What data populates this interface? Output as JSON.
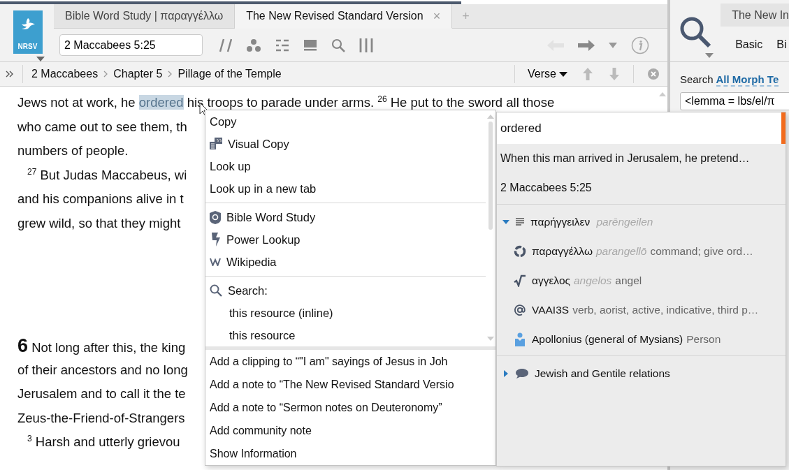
{
  "logo": {
    "label": "NRSV"
  },
  "tabs": [
    {
      "label": "Bible Word Study | παραγγέλλω",
      "selected": false
    },
    {
      "label": "The New Revised Standard Version",
      "selected": true,
      "close": "×"
    }
  ],
  "new_tab": "+",
  "reference_field": {
    "value": "2 Maccabees 5:25"
  },
  "history": {
    "back": {
      "disabled": true
    },
    "forward": {
      "disabled": false
    }
  },
  "breadcrumb": [
    "2 Maccabees",
    "Chapter 5",
    "Pillage of the Temple"
  ],
  "verse_dropdown": {
    "label": "Verse"
  },
  "text_lines": [
    {
      "parts": [
        {
          "kind": "text",
          "t": "Jews not at work, he "
        },
        {
          "kind": "selection",
          "t": "ordered"
        },
        {
          "kind": "text",
          "t": " his troops to parade under arms. "
        },
        {
          "kind": "verse",
          "t": "26"
        },
        {
          "kind": "text",
          "t": " He put to the sword all those"
        }
      ]
    },
    {
      "parts": [
        {
          "kind": "text",
          "t": "who came out to see them, th"
        }
      ]
    },
    {
      "parts": [
        {
          "kind": "text",
          "t": "numbers of people."
        }
      ]
    },
    {
      "indent": true,
      "parts": [
        {
          "kind": "verse",
          "t": "27"
        },
        {
          "kind": "text",
          "t": " But Judas Maccabeus, wi"
        }
      ]
    },
    {
      "parts": [
        {
          "kind": "text",
          "t": "and his companions alive in t"
        }
      ]
    },
    {
      "parts": [
        {
          "kind": "text",
          "t": "grew wild, so that they might"
        }
      ]
    },
    {
      "gap_before": true,
      "parts": [
        {
          "kind": "chapter",
          "t": "6"
        },
        {
          "kind": "text",
          "t": " Not long after this, the king"
        }
      ]
    },
    {
      "parts": [
        {
          "kind": "text",
          "t": "of their ancestors and no long"
        }
      ]
    },
    {
      "parts": [
        {
          "kind": "text",
          "t": "Jerusalem and to call it the te"
        }
      ]
    },
    {
      "parts": [
        {
          "kind": "text",
          "t": "Zeus-the-Friend-of-Strangers"
        }
      ]
    },
    {
      "indent": true,
      "parts": [
        {
          "kind": "verse",
          "t": "3"
        },
        {
          "kind": "text",
          "t": " Harsh and utterly grievou"
        }
      ]
    }
  ],
  "context_menu": {
    "sections": [
      {
        "items": [
          {
            "label": "Copy",
            "kind": "plain"
          },
          {
            "label": "Visual Copy",
            "kind": "icon"
          },
          {
            "label": "Look up",
            "kind": "plain"
          },
          {
            "label": "Look up in a new tab",
            "kind": "plain"
          }
        ]
      },
      {
        "items": [
          {
            "label": "Bible Word Study",
            "kind": "icon"
          },
          {
            "label": "Power Lookup",
            "kind": "icon"
          },
          {
            "label": "Wikipedia",
            "kind": "icon"
          }
        ]
      },
      {
        "items": [
          {
            "label": "Search:",
            "kind": "icon"
          },
          {
            "label": "this resource (inline)",
            "kind": "sub"
          },
          {
            "label": "this resource",
            "kind": "sub"
          }
        ]
      }
    ],
    "lower_items": [
      "Add a clipping to “\"I am\" sayings of Jesus in Joh",
      "Add a note to “The New Revised Standard Versio",
      "Add a note to “Sermon notes on Deuteronomy”",
      "Add community note",
      "Show Information"
    ]
  },
  "info_panel": {
    "word": "ordered",
    "excerpt": "When this man arrived in Jerusalem, he pretend…",
    "reference": "2 Maccabees 5:25",
    "tree": [
      {
        "lemma": "παρήγγειλεν",
        "translit": "parēngeilen",
        "expanded": true,
        "children": [
          {
            "lemma": "παραγγέλλω",
            "translit": "parangellō",
            "gloss": "command; give ord…"
          },
          {
            "lemma": "αγγελος",
            "translit": "angelos",
            "gloss": "angel"
          },
          {
            "lemma": "VAAI3S",
            "gloss": "verb, aorist, active, indicative, third p…"
          },
          {
            "lemma": "Apollonius (general of Mysians)",
            "gloss": "Person"
          }
        ]
      }
    ],
    "topics": [
      {
        "label": "Jewish and Gentile relations",
        "expanded": false
      }
    ]
  },
  "search_panel": {
    "tab": "The New In",
    "modes": [
      "Basic",
      "Bi"
    ],
    "label": "Search",
    "scope": "All Morph Te",
    "query": "<lemma = lbs/el/π"
  }
}
